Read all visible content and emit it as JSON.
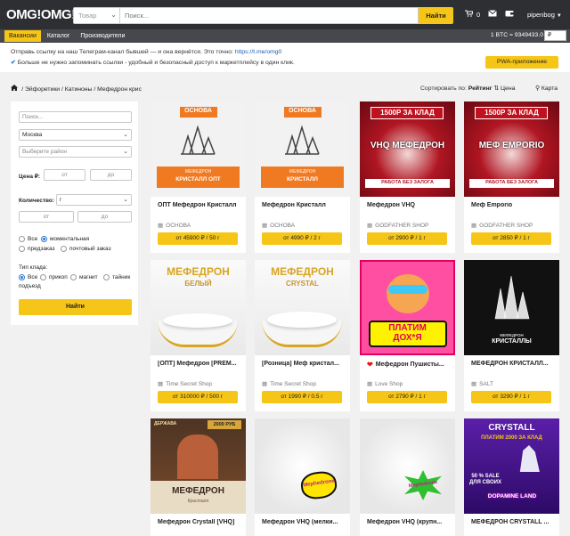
{
  "header": {
    "logo": "OMG!OMG!",
    "search_category": "Товар",
    "search_placeholder": "Поиск...",
    "search_button": "Найти",
    "cart_count": "0",
    "username": "pipenbog"
  },
  "nav": {
    "items": [
      {
        "label": "Вакансии",
        "active": true
      },
      {
        "label": "Каталог",
        "active": false
      },
      {
        "label": "Производители",
        "active": false
      }
    ],
    "btc_rate": "1 BTC = 9349433.0",
    "currency": "₽"
  },
  "notice": {
    "line1_text": "Отправь ссылку на наш Телеграм-канал бывшей — и она вернётся. Это точно:",
    "line1_link": "https://t.me/omg0",
    "line2_text": "Больше не нужно запоминать ссылки - удобный и безопасный доступ к маркетплейсу в один клик.",
    "pwa_button": "PWA-приложение"
  },
  "breadcrumbs": {
    "items": [
      "Эйфоретики",
      "Катиноны",
      "Мефедрон крис"
    ]
  },
  "sort": {
    "label": "Сортировать по:",
    "rating": "Рейтинг",
    "price": "Цена",
    "map": "Карта"
  },
  "filters": {
    "search_placeholder": "Поиск...",
    "city": "Москва",
    "district_placeholder": "Выберите район",
    "price_label": "Цена ₽:",
    "price_from": "от",
    "price_to": "до",
    "qty_label": "Количество:",
    "qty_unit": "г",
    "qty_from": "от",
    "qty_to": "до",
    "delivery_options": [
      "Все",
      "моментальная",
      "предзаказ",
      "почтовый заказ"
    ],
    "delivery_selected": "моментальная",
    "stash_label": "Тип клада:",
    "stash_options": [
      "Все",
      "прикоп",
      "магнит",
      "тайник",
      "подъезд"
    ],
    "stash_selected": "Все",
    "apply_button": "Найти"
  },
  "products": [
    {
      "title": "ОПТ Мефедрон Кристалл",
      "shop": "ОСНОВА",
      "price": "от 45900 ₽ / 50 г",
      "img_top": "ОСНОВА",
      "img_bottom": "КРИСТАЛЛ ОПТ",
      "img_sub": "МЕФЕДРОН"
    },
    {
      "title": "Мефедрон Кристалл",
      "shop": "ОСНОВА",
      "price": "от 4990 ₽ / 2 г",
      "img_top": "ОСНОВА",
      "img_bottom": "КРИСТАЛЛ",
      "img_sub": "МЕФЕДРОН"
    },
    {
      "title": "Мефедрон VHQ",
      "shop": "GODFATHER SHOP",
      "price": "от 2900 ₽ / 1 г",
      "img_top": "1500Р ЗА КЛАД",
      "img_mid": "VHQ МЕФЕДРОН",
      "img_bottom": "РАБОТА БЕЗ ЗАЛОГА"
    },
    {
      "title": "Меф Emporio",
      "shop": "GODFATHER SHOP",
      "price": "от 2850 ₽ / 1 г",
      "img_top": "1500Р ЗА КЛАД",
      "img_mid": "МЕФ EMPORIO",
      "img_bottom": "РАБОТА БЕЗ ЗАЛОГА"
    },
    {
      "title": "[ОПТ] Мефедрон [PREM...",
      "shop": "Time Secret Shop",
      "price": "от 310000 ₽ / 500 г",
      "img_top": "МЕФЕДРОН",
      "img_mid": "БЕЛЫЙ"
    },
    {
      "title": "[Розница] Меф кристал...",
      "shop": "Time Secret Shop",
      "price": "от 1990 ₽ / 0.5 г",
      "img_top": "МЕФЕДРОН",
      "img_mid": "CRYSTAL"
    },
    {
      "title": "Мефедрон Пушисты...",
      "shop": "Love Shop",
      "price": "от 2790 ₽ / 1 г",
      "img_bottom": "ПЛАТИМ ДОХ*Я",
      "heart": true
    },
    {
      "title": "МЕФЕДРОН КРИСТАЛЛ...",
      "shop": "SALT",
      "price": "от 3290 ₽ / 1 г",
      "img_sub": "МЕФЕДРОН",
      "img_bottom": "КРИСТАЛЛЫ"
    },
    {
      "title": "Мефедрон Crystall [VHQ]",
      "img_top": "ДЕРЖАВА",
      "img_price": "2000 РУБ",
      "img_bottom": "МЕФЕДРОН",
      "img_sub": "Кристалл"
    },
    {
      "title": "Мефедрон VHQ (мелки...",
      "img_sticker": "Mephedrone"
    },
    {
      "title": "Мефедрон VHQ (крупн...",
      "img_sticker": "Mephedrone"
    },
    {
      "title": "МЕФЕДРОН CRYSTALL ...",
      "img_top": "CRYSTALL",
      "img_mid": "ПЛАТИМ 2000 ЗА КЛАД",
      "img_sale": "50 % SALE ДЛЯ СВОИХ",
      "img_bottom": "DOPAMINE LAND"
    }
  ],
  "colors": {
    "accent": "#f5c518",
    "topbar": "#2d2f33",
    "navbar": "#46484d"
  }
}
